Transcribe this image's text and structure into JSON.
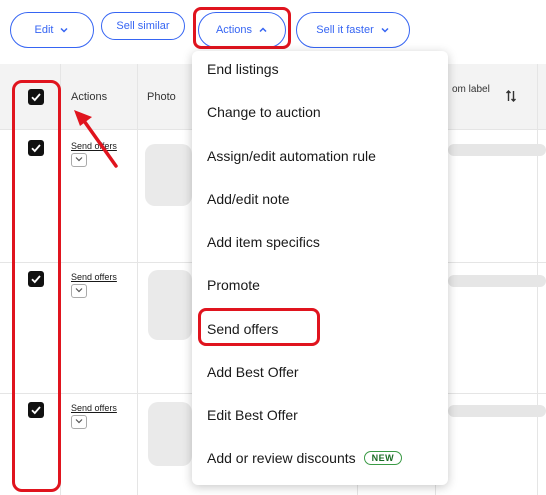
{
  "toolbar": {
    "edit_label": "Edit",
    "sell_similar_label": "Sell similar",
    "actions_label": "Actions",
    "sell_faster_label": "Sell it faster"
  },
  "table": {
    "headers": {
      "actions": "Actions",
      "photo": "Photo",
      "custom_label": "om label",
      "sort_icon": "sort-icon"
    },
    "rows": [
      {
        "selected": true,
        "action_link": "Send offers"
      },
      {
        "selected": true,
        "action_link": "Send offers"
      },
      {
        "selected": true,
        "action_link": "Send offers"
      }
    ]
  },
  "actions_menu": {
    "items": [
      {
        "label": "End listings"
      },
      {
        "label": "Change to auction"
      },
      {
        "label": "Assign/edit automation rule"
      },
      {
        "label": "Add/edit note"
      },
      {
        "label": "Add item specifics"
      },
      {
        "label": "Promote"
      },
      {
        "label": "Send offers",
        "highlighted": true
      },
      {
        "label": "Add Best Offer"
      },
      {
        "label": "Edit Best Offer"
      },
      {
        "label": "Add or review discounts",
        "badge": "NEW"
      }
    ]
  },
  "colors": {
    "accent": "#3665f3",
    "highlight_outline": "#e0141e",
    "badge_green": "#3a9a45"
  }
}
